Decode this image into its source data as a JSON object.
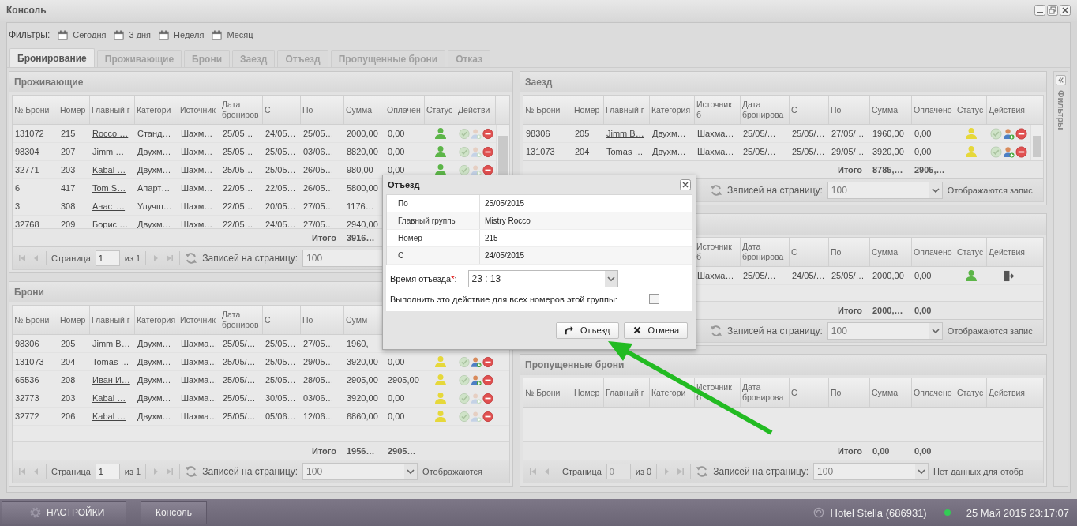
{
  "window": {
    "title": "Консоль"
  },
  "filters": {
    "label": "Фильтры:",
    "items": [
      "Сегодня",
      "3 дня",
      "Неделя",
      "Месяц"
    ]
  },
  "tabs": [
    {
      "label": "Бронирование",
      "selected": true
    },
    {
      "label": "Проживающие",
      "selected": false
    },
    {
      "label": "Брони",
      "selected": false
    },
    {
      "label": "Заезд",
      "selected": false
    },
    {
      "label": "Отъезд",
      "selected": false
    },
    {
      "label": "Пропущенные брони",
      "selected": false
    },
    {
      "label": "Отказ",
      "selected": false
    }
  ],
  "side_panel": {
    "title": "Фильтры"
  },
  "panels": [
    {
      "title": "Проживающие",
      "columns": [
        "№ Брони",
        "Номер",
        "Главный г",
        "Категори",
        "Источник",
        "Дата брониров",
        "С",
        "По",
        "Сумма",
        "Оплачен",
        "Статус",
        "Действи"
      ],
      "rows": [
        {
          "cells": [
            "131072",
            "215",
            "Rocco …",
            "Станд…",
            "Шахм…",
            "25/05…",
            "24/05…",
            "25/05…",
            "2000,00",
            "0,00"
          ],
          "color": "#5cb548",
          "kind": "standard",
          "guest_action_disabled": true
        },
        {
          "cells": [
            "98304",
            "207",
            "Jimm …",
            "Двухм…",
            "Шахм…",
            "25/05…",
            "25/05…",
            "03/06…",
            "8820,00",
            "0,00"
          ],
          "color": "#5cb548",
          "kind": "standard",
          "guest_action_disabled": true
        },
        {
          "cells": [
            "32771",
            "203",
            "Kabal …",
            "Двухм…",
            "Шахм…",
            "25/05…",
            "25/05…",
            "26/05…",
            "980,00",
            "0,00"
          ],
          "color": "#5cb548",
          "kind": "standard",
          "guest_action_disabled": true
        },
        {
          "cells": [
            "6",
            "417",
            "Tom S…",
            "Апарт…",
            "Шахм…",
            "22/05…",
            "22/05…",
            "26/05…",
            "5800,00",
            null
          ]
        },
        {
          "cells": [
            "3",
            "308",
            "Анаст…",
            "Улучш…",
            "Шахм…",
            "22/05…",
            "20/05…",
            "27/05…",
            "1176…",
            null
          ]
        },
        {
          "cells": [
            "32768",
            "209",
            "Борис …",
            "Двухм…",
            "Шахм…",
            "22/05…",
            "24/05…",
            "27/05…",
            "2940,00",
            null
          ]
        }
      ],
      "totals": {
        "label": "Итого",
        "sum": "3916…"
      },
      "paging": {
        "page_label": "Страница",
        "page": "1",
        "page_disabled": false,
        "of": "из 1",
        "per_page_label": "Записей на страницу:",
        "per_page": "100"
      }
    },
    {
      "title": "Брони",
      "columns": [
        "№ Брони",
        "Номер",
        "Главный г",
        "Категория",
        "Источник",
        "Дата брониров",
        "С",
        "По",
        "Сумм",
        null,
        null,
        null
      ],
      "rows": [
        {
          "cells": [
            "98306",
            "205",
            "Jimm B…",
            "Двухм…",
            "Шахма…",
            "25/05/…",
            "25/05…",
            "27/05…",
            "1960,",
            null
          ]
        },
        {
          "cells": [
            "131073",
            "204",
            "Tomas …",
            "Двухм…",
            "Шахма…",
            "25/05/…",
            "25/05…",
            "29/05…",
            "3920,00",
            "0,00"
          ],
          "color": "#e6d83a",
          "kind": "standard",
          "guest_action_disabled": false
        },
        {
          "cells": [
            "65536",
            "208",
            "Иван И…",
            "Двухм…",
            "Шахма…",
            "25/05/…",
            "25/05…",
            "28/05…",
            "2905,00",
            "2905,00"
          ],
          "color": "#e6d83a",
          "kind": "standard",
          "guest_action_disabled": false
        },
        {
          "cells": [
            "32773",
            "203",
            "Kabal …",
            "Двухм…",
            "Шахма…",
            "25/05/…",
            "30/05…",
            "03/06…",
            "3920,00",
            "0,00"
          ],
          "color": "#e6d83a",
          "kind": "standard",
          "guest_action_disabled": true
        },
        {
          "cells": [
            "32772",
            "206",
            "Kabal …",
            "Двухм…",
            "Шахма…",
            "25/05/…",
            "05/06…",
            "12/06…",
            "6860,00",
            "0,00"
          ],
          "color": "#e6d83a",
          "kind": "standard",
          "guest_action_disabled": true
        }
      ],
      "totals": {
        "label": "Итого",
        "sum": "1956…",
        "paid": "2905…"
      },
      "paging": {
        "page_label": "Страница",
        "page": "1",
        "page_disabled": false,
        "of": "из 1",
        "per_page_label": "Записей на страницу:",
        "per_page": "100",
        "info": "Отображаются"
      }
    },
    {
      "title": "Заезд",
      "columns": [
        "№ Брони",
        "Номер",
        "Главный г",
        "Категория",
        "Источник б",
        "Дата бронирова",
        "С",
        "По",
        "Сумма",
        "Оплачено",
        "Статус",
        "Действия"
      ],
      "rows": [
        {
          "cells": [
            "98306",
            "205",
            "Jimm B…",
            "Двухм…",
            "Шахма…",
            "25/05/…",
            "25/05/…",
            "27/05/…",
            "1960,00",
            "0,00"
          ],
          "color": "#e6d83a",
          "kind": "standard",
          "guest_action_disabled": false
        },
        {
          "cells": [
            "131073",
            "204",
            "Tomas …",
            "Двухм…",
            "Шахма…",
            "25/05/…",
            "25/05/…",
            "29/05/…",
            "3920,00",
            "0,00"
          ],
          "color": "#e6d83a",
          "kind": "standard",
          "guest_action_disabled": false
        }
      ],
      "totals": {
        "label": "Итого",
        "sum": "8785,…",
        "paid": "2905,…"
      },
      "paging": {
        "per_page_label": "Записей на страницу:",
        "per_page": "100",
        "info": "Отображаются запис"
      }
    },
    {
      "columns": [
        null,
        null,
        null,
        null,
        "Источник б",
        "Дата бронирова",
        "С",
        "По",
        "Сумма",
        "Оплачено",
        "Статус",
        "Действия"
      ],
      "rows": [
        {
          "cells": [
            null,
            null,
            null,
            null,
            "Шахма…",
            "25/05/…",
            "24/05/…",
            "25/05/…",
            "2000,00",
            "0,00"
          ],
          "color": "#5cb548",
          "kind": "departure"
        }
      ],
      "totals": {
        "label": "Итого",
        "sum": "2000,…",
        "paid": "0,00"
      },
      "paging": {
        "per_page_label": "Записей на страницу:",
        "per_page": "100",
        "info": "Отображаются запис"
      }
    },
    {
      "title": "Пропущенные брони",
      "columns": [
        "№ Брони",
        "Номер",
        "Главный г",
        "Категори",
        "Источник б",
        "Дата бронирова",
        "С",
        "По",
        "Сумма",
        "Оплачено",
        "Статус",
        "Действия"
      ],
      "totals": {
        "label": "Итого",
        "sum": "0,00",
        "paid": "0,00"
      },
      "paging": {
        "page_label": "Страница",
        "page": "0",
        "page_disabled": true,
        "of": "из 0",
        "per_page_label": "Записей на страницу:",
        "per_page": "100",
        "info": "Нет данных для отобр"
      }
    }
  ],
  "dialog": {
    "title": "Отъезд",
    "details": [
      {
        "label": "По",
        "value": "25/05/2015"
      },
      {
        "label": "Главный группы",
        "value": "Mistry Rocco"
      },
      {
        "label": "Номер",
        "value": "215"
      },
      {
        "label": "С",
        "value": "24/05/2015"
      }
    ],
    "time": {
      "label": "Время отъезда",
      "required_mark": "*",
      "colon": ":",
      "value": "23 : 13"
    },
    "group_option": {
      "label": "Выполнить это действие для всех номеров этой группы:",
      "checked": false
    },
    "buttons": [
      {
        "label": "Отъезд",
        "kind": "confirm"
      },
      {
        "label": "Отмена",
        "kind": "cancel"
      }
    ]
  },
  "taskbar": {
    "buttons": [
      {
        "label": "НАСТРОЙКИ",
        "kind": "settings"
      },
      {
        "label": "Консоль",
        "kind": "window"
      }
    ],
    "hotel": "Hotel Stella (686931)",
    "online": true,
    "datetime": "25 Май 2015 23:17:07"
  }
}
